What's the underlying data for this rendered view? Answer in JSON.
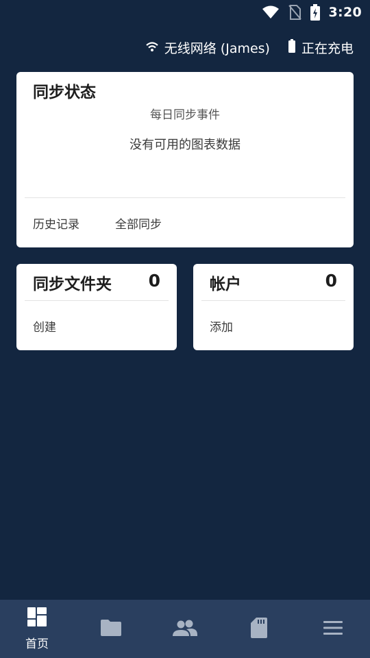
{
  "status_bar": {
    "time": "3:20",
    "icons": [
      "wifi-icon",
      "no-sim-icon",
      "battery-charging-icon"
    ]
  },
  "connection": {
    "wifi_label": "无线网络 (James)",
    "charging_label": "正在充电"
  },
  "sync_status": {
    "title": "同步状态",
    "chart_title": "每日同步事件",
    "chart_empty_text": "没有可用的图表数据",
    "history_label": "历史记录",
    "sync_all_label": "全部同步"
  },
  "sync_folders": {
    "title": "同步文件夹",
    "count": "0",
    "action_label": "创建"
  },
  "accounts": {
    "title": "帐户",
    "count": "0",
    "action_label": "添加"
  },
  "bottom_nav": {
    "items": [
      {
        "icon": "dashboard-icon",
        "label": "首页",
        "active": true
      },
      {
        "icon": "folder-icon"
      },
      {
        "icon": "people-icon"
      },
      {
        "icon": "sd-card-icon"
      },
      {
        "icon": "menu-icon"
      }
    ]
  },
  "colors": {
    "background": "#132640",
    "nav_background": "#2a3f5f",
    "card": "#ffffff",
    "inactive_icon": "#a8b3c3"
  }
}
